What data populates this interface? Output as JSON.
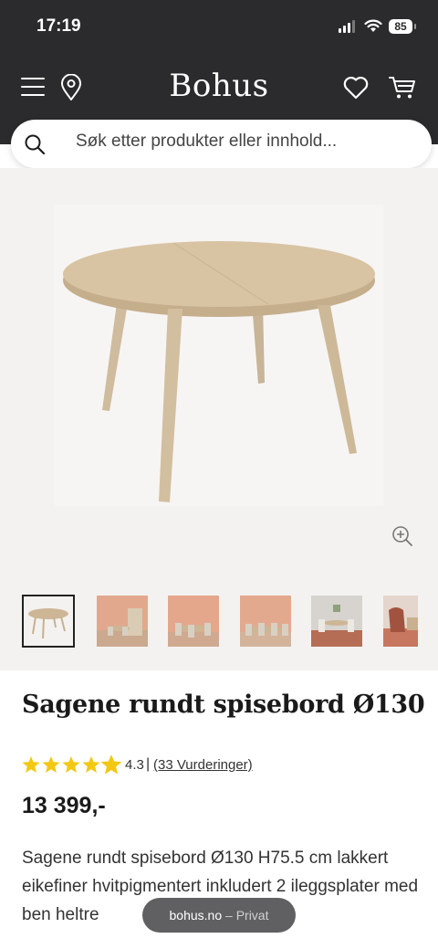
{
  "status_bar": {
    "time": "17:19",
    "battery": "85"
  },
  "header": {
    "logo": "Bohus"
  },
  "search": {
    "placeholder": "Søk etter produkter eller innhold..."
  },
  "product": {
    "title": "Sagene rundt spisebord Ø130",
    "rating": "4.3",
    "rating_separator": "|",
    "reviews": "(33 Vurderinger)",
    "stars": 4.3,
    "price": "13 399,-",
    "description": "Sagene rundt spisebord Ø130 H75.5 cm lakkert eikefiner hvitpigmentert inkludert 2 ileggsplater med ben heltre"
  },
  "toast": {
    "domain": "bohus.no",
    "suffix": "– Privat"
  },
  "colors": {
    "header_bg": "#2b2b2d",
    "star": "#f2c811",
    "gallery_bg": "#f4f2f0"
  },
  "icons": [
    "menu-icon",
    "location-pin-icon",
    "heart-icon",
    "cart-icon",
    "search-icon",
    "zoom-in-icon"
  ]
}
